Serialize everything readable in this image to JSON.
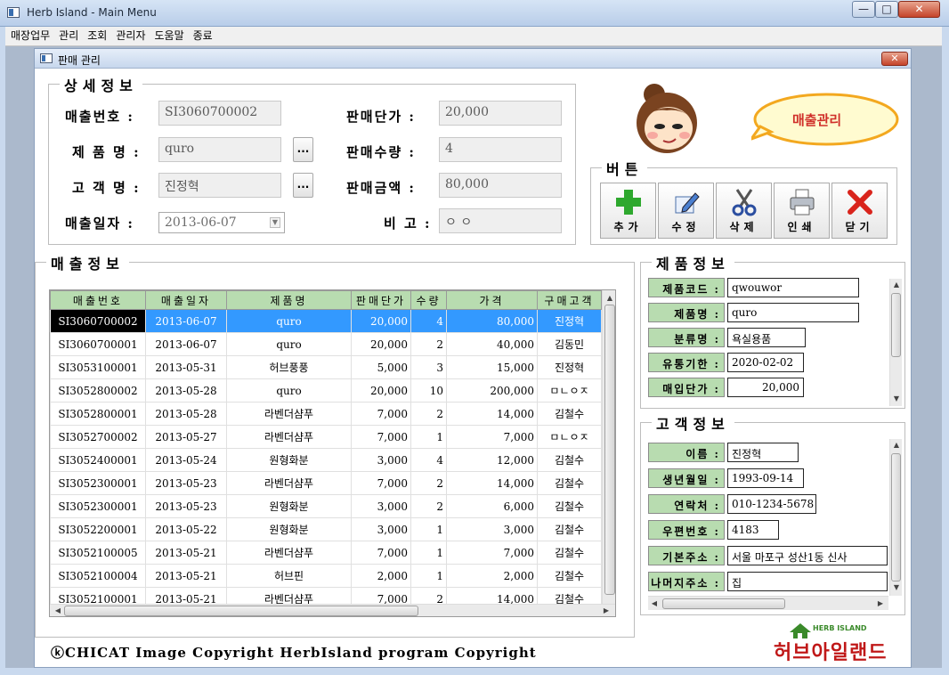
{
  "window": {
    "title": "Herb Island - Main Menu",
    "min_label": "—",
    "max_label": "□",
    "close_label": "✕"
  },
  "menu": {
    "items": [
      "매장업무",
      "관리",
      "조회",
      "관리자",
      "도움말",
      "종료"
    ]
  },
  "child_window": {
    "title": "판매 관리",
    "close_label": "✕"
  },
  "detail": {
    "legend": "상세정보",
    "sales_no_label": "매출번호 :",
    "sales_no": "SI3060700002",
    "product_label": "제 품 명 :",
    "product": "quro",
    "customer_label": "고 객 명 :",
    "customer": "진정혁",
    "date_label": "매출일자 :",
    "date": "2013-06-07",
    "unit_price_label": "판매단가 :",
    "unit_price": "20,000",
    "qty_label": "판매수량 :",
    "qty": "4",
    "amount_label": "판매금액 :",
    "amount": "80,000",
    "note_label": "비 고 :",
    "note": "ㅇ ㅇ",
    "ellipsis": "..."
  },
  "speech": {
    "text": "매출관리"
  },
  "buttons_panel": {
    "legend": "버튼",
    "add": "추가",
    "edit": "수정",
    "delete": "삭제",
    "print": "인쇄",
    "close": "닫기"
  },
  "sales": {
    "legend": "매출정보",
    "columns": [
      "매출번호",
      "매출일자",
      "제품명",
      "판매단가",
      "수량",
      "가격",
      "구매고객"
    ],
    "rows": [
      [
        "SI3060700002",
        "2013-06-07",
        "quro",
        "20,000",
        "4",
        "80,000",
        "진정혁"
      ],
      [
        "SI3060700001",
        "2013-06-07",
        "quro",
        "20,000",
        "2",
        "40,000",
        "김동민"
      ],
      [
        "SI3053100001",
        "2013-05-31",
        "허브풍풍",
        "5,000",
        "3",
        "15,000",
        "진정혁"
      ],
      [
        "SI3052800002",
        "2013-05-28",
        "quro",
        "20,000",
        "10",
        "200,000",
        "ㅁㄴㅇㅈ"
      ],
      [
        "SI3052800001",
        "2013-05-28",
        "라벤더샴푸",
        "7,000",
        "2",
        "14,000",
        "김철수"
      ],
      [
        "SI3052700002",
        "2013-05-27",
        "라벤더샴푸",
        "7,000",
        "1",
        "7,000",
        "ㅁㄴㅇㅈ"
      ],
      [
        "SI3052400001",
        "2013-05-24",
        "원형화분",
        "3,000",
        "4",
        "12,000",
        "김철수"
      ],
      [
        "SI3052300001",
        "2013-05-23",
        "라벤더샴푸",
        "7,000",
        "2",
        "14,000",
        "김철수"
      ],
      [
        "SI3052300001",
        "2013-05-23",
        "원형화분",
        "3,000",
        "2",
        "6,000",
        "김철수"
      ],
      [
        "SI3052200001",
        "2013-05-22",
        "원형화분",
        "3,000",
        "1",
        "3,000",
        "김철수"
      ],
      [
        "SI3052100005",
        "2013-05-21",
        "라벤더샴푸",
        "7,000",
        "1",
        "7,000",
        "김철수"
      ],
      [
        "SI3052100004",
        "2013-05-21",
        "허브핀",
        "2,000",
        "1",
        "2,000",
        "김철수"
      ],
      [
        "SI3052100001",
        "2013-05-21",
        "라벤더샴푸",
        "7,000",
        "2",
        "14,000",
        "김철수"
      ]
    ]
  },
  "product_info": {
    "legend": "제품정보",
    "fields": [
      {
        "label": "제품코드 :",
        "value": "qwouwor"
      },
      {
        "label": "제품명 :",
        "value": "quro"
      },
      {
        "label": "분류명 :",
        "value": "욕실용품"
      },
      {
        "label": "유통기한 :",
        "value": "2020-02-02"
      },
      {
        "label": "매입단가 :",
        "value": "20,000"
      }
    ]
  },
  "customer_info": {
    "legend": "고객정보",
    "fields": [
      {
        "label": "이름 :",
        "value": "진정혁"
      },
      {
        "label": "생년월일 :",
        "value": "1993-09-14"
      },
      {
        "label": "연락처 :",
        "value": "010-1234-5678"
      },
      {
        "label": "우편번호 :",
        "value": "4183"
      },
      {
        "label": "기본주소 :",
        "value": "서울 마포구 성산1동 신사"
      },
      {
        "label": "나머지주소 :",
        "value": "집"
      }
    ]
  },
  "footer": {
    "copyright": "ⓚCHICAT Image Copyright HerbIsland program Copyright",
    "logo_small": "HERB ISLAND",
    "logo_big": "허브아일랜드"
  },
  "colors": {
    "header_green": "#b8dcb0",
    "selection_blue": "#3399ff",
    "add_icon": "#2ea82e",
    "close_icon": "#d9241c"
  }
}
